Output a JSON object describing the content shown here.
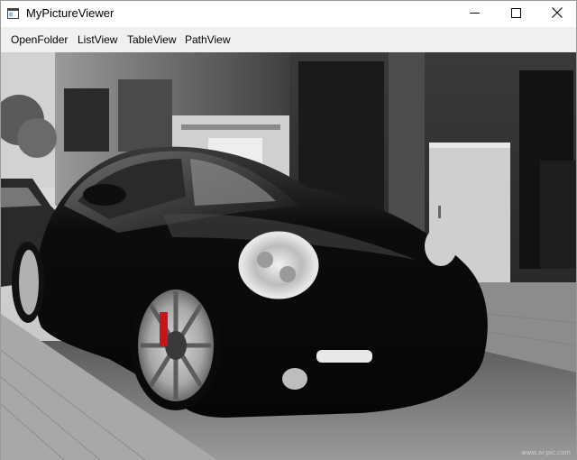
{
  "window": {
    "title": "MyPictureViewer",
    "app_icon": "window-app-icon",
    "controls": {
      "minimize_icon": "minimize-icon",
      "maximize_icon": "maximize-icon",
      "close_icon": "close-icon"
    }
  },
  "menubar": {
    "items": [
      {
        "label": "OpenFolder"
      },
      {
        "label": "ListView"
      },
      {
        "label": "TableView"
      },
      {
        "label": "PathView"
      }
    ]
  },
  "image": {
    "description_icon": "photo-viewer-image",
    "watermark": "www.ai-pic.com"
  },
  "colors": {
    "titlebar": "#ffffff",
    "menubar": "#f0f0f0",
    "border": "#9a9a9a",
    "brake_caliper": "#c8141b"
  }
}
